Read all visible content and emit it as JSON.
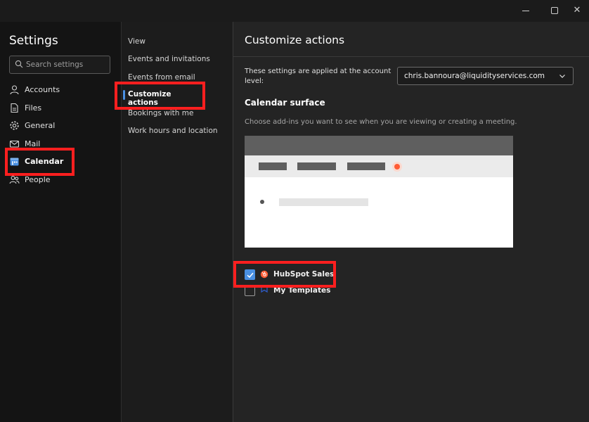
{
  "window": {
    "minimize_icon": "minimize-icon",
    "maximize_icon": "maximize-icon",
    "close_icon": "close-icon",
    "close_glyph": "✕"
  },
  "settings": {
    "title": "Settings",
    "search_placeholder": "Search settings",
    "nav": [
      {
        "label": "Accounts",
        "icon": "person-icon"
      },
      {
        "label": "Files",
        "icon": "file-icon"
      },
      {
        "label": "General",
        "icon": "gear-icon"
      },
      {
        "label": "Mail",
        "icon": "mail-icon"
      },
      {
        "label": "Calendar",
        "icon": "calendar-icon",
        "selected": true
      },
      {
        "label": "People",
        "icon": "people-icon"
      }
    ]
  },
  "calendar_nav": {
    "items": [
      {
        "label": "View"
      },
      {
        "label": "Events and invitations"
      },
      {
        "label": "Events from email"
      },
      {
        "label": "Customize actions",
        "selected": true
      },
      {
        "label": "Bookings with me"
      },
      {
        "label": "Work hours and location"
      }
    ]
  },
  "panel": {
    "title": "Customize actions",
    "account_description": "These settings are applied at the account level:",
    "account_value": "chris.bannoura@liquidityservices.com",
    "section_title": "Calendar surface",
    "section_description": "Choose add-ins you want to see when you are viewing or creating a meeting.",
    "addins": [
      {
        "label": "HubSpot Sales",
        "checked": true,
        "icon": "hubspot-icon"
      },
      {
        "label": "My Templates",
        "checked": false,
        "icon": "templates-icon"
      }
    ]
  },
  "colors": {
    "accent": "#4a90e2",
    "highlight": "#ff1f1f",
    "hubspot": "#ff5c35"
  }
}
